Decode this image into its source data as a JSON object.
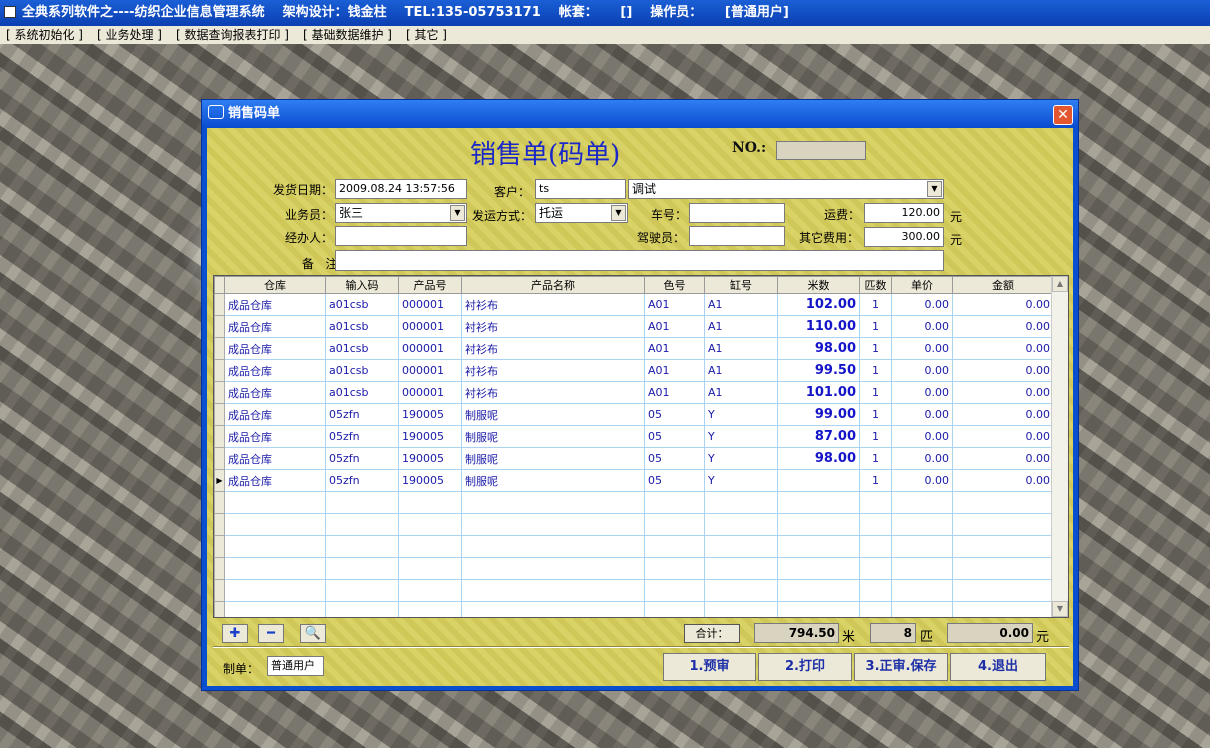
{
  "app": {
    "title": "全典系列软件之----纺织企业信息管理系统",
    "designer": "架构设计：钱金柱",
    "tel": "TEL:135-05753171",
    "account": "帐套：     []",
    "operator": "操作员：     [普通用户]"
  },
  "menu": [
    "[ 系统初始化 ]",
    "[ 业务处理 ]",
    "[ 数据查询报表打印 ]",
    "[ 基础数据维护 ]",
    "[ 其它 ]"
  ],
  "dialog": {
    "title": "销售码单",
    "heading": "销售单(码单)",
    "no_label": "NO.:",
    "no_value": ""
  },
  "form": {
    "ship_date_label": "发货日期：",
    "ship_date": "2009.08.24 13:57:56",
    "customer_label": "客户：",
    "customer_code": "ts",
    "customer_name": "调试",
    "salesman_label": "业务员：",
    "salesman": "张三",
    "ship_method_label": "发运方式：",
    "ship_method": "托运",
    "car_no_label": "车号：",
    "car_no": "",
    "freight_label": "运费：",
    "freight": "120.00",
    "freight_unit": "元",
    "handler_label": "经办人：",
    "handler": "",
    "driver_label": "驾驶员：",
    "driver": "",
    "other_fee_label": "其它费用：",
    "other_fee": "300.00",
    "other_fee_unit": "元",
    "remark_label": "备   注：",
    "remark": ""
  },
  "grid": {
    "columns": [
      "仓库",
      "输入码",
      "产品号",
      "产品名称",
      "色号",
      "缸号",
      "米数",
      "匹数",
      "单价",
      "金额"
    ],
    "rows": [
      [
        "成品仓库",
        "a01csb",
        "000001",
        "衬衫布",
        "A01",
        "A1",
        "102.00",
        "1",
        "0.00",
        "0.00"
      ],
      [
        "成品仓库",
        "a01csb",
        "000001",
        "衬衫布",
        "A01",
        "A1",
        "110.00",
        "1",
        "0.00",
        "0.00"
      ],
      [
        "成品仓库",
        "a01csb",
        "000001",
        "衬衫布",
        "A01",
        "A1",
        "98.00",
        "1",
        "0.00",
        "0.00"
      ],
      [
        "成品仓库",
        "a01csb",
        "000001",
        "衬衫布",
        "A01",
        "A1",
        "99.50",
        "1",
        "0.00",
        "0.00"
      ],
      [
        "成品仓库",
        "a01csb",
        "000001",
        "衬衫布",
        "A01",
        "A1",
        "101.00",
        "1",
        "0.00",
        "0.00"
      ],
      [
        "成品仓库",
        "05zfn",
        "190005",
        "制服呢",
        "05",
        "Y",
        "99.00",
        "1",
        "0.00",
        "0.00"
      ],
      [
        "成品仓库",
        "05zfn",
        "190005",
        "制服呢",
        "05",
        "Y",
        "87.00",
        "1",
        "0.00",
        "0.00"
      ],
      [
        "成品仓库",
        "05zfn",
        "190005",
        "制服呢",
        "05",
        "Y",
        "98.00",
        "1",
        "0.00",
        "0.00"
      ],
      [
        "成品仓库",
        "05zfn",
        "190005",
        "制服呢",
        "05",
        "Y",
        "",
        "1",
        "0.00",
        "0.00"
      ]
    ],
    "current_row": 8,
    "empty_rows": 6
  },
  "totals": {
    "label": "合计：",
    "meters": "794.50",
    "meters_unit": "米",
    "pieces": "8",
    "pieces_unit": "匹",
    "amount": "0.00",
    "amount_unit": "元"
  },
  "footer": {
    "maker_label": "制单：",
    "maker": "普通用户",
    "btn_prereview": "1.预审",
    "btn_print": "2.打印",
    "btn_approve_save": "3.正审.保存",
    "btn_exit": "4.退出"
  },
  "toolbar_icons": [
    "plus-icon",
    "minus-icon",
    "magnifier-icon"
  ]
}
